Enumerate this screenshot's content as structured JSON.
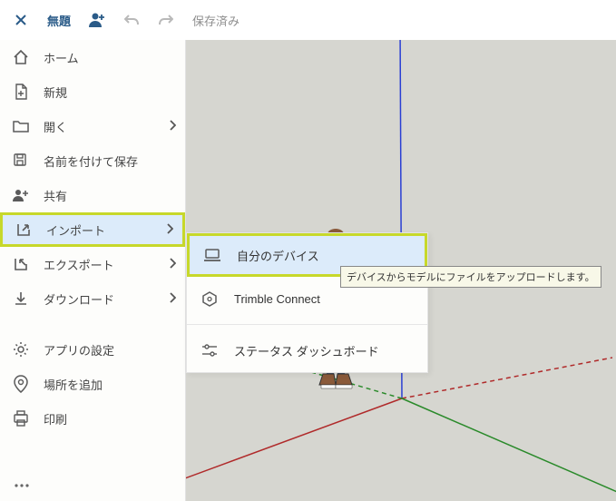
{
  "toolbar": {
    "title": "無題",
    "status": "保存済み"
  },
  "menu": {
    "home": "ホーム",
    "new": "新規",
    "open": "開く",
    "saveAs": "名前を付けて保存",
    "share": "共有",
    "import": "インポート",
    "export": "エクスポート",
    "download": "ダウンロード",
    "appSettings": "アプリの設定",
    "addLocation": "場所を追加",
    "print": "印刷"
  },
  "submenu": {
    "myDevice": "自分のデバイス",
    "trimbleConnect": "Trimble Connect",
    "statusDashboard": "ステータス ダッシュボード"
  },
  "tooltip": "デバイスからモデルにファイルをアップロードします。"
}
